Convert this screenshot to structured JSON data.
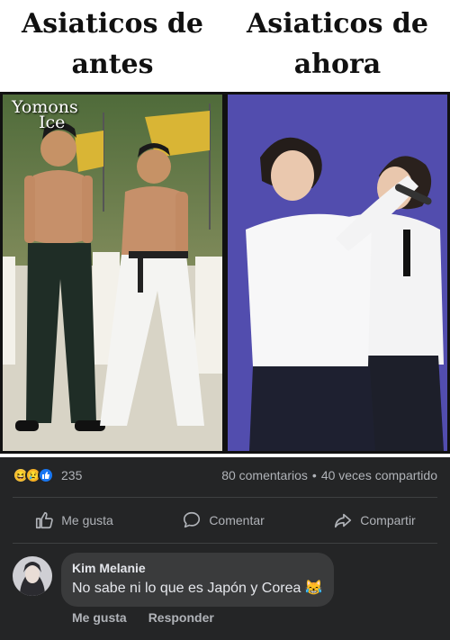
{
  "meme": {
    "left_title_line1": "Asiaticos de",
    "left_title_line2": "antes",
    "right_title_line1": "Asiaticos de",
    "right_title_line2": "ahora",
    "watermark_line1": "Yomons",
    "watermark_line2": "Ice"
  },
  "post_stats": {
    "reaction_icons": [
      "haha-icon",
      "sad-icon",
      "like-icon"
    ],
    "reaction_count": "235",
    "comments": "80 comentarios",
    "separator": "•",
    "shares": "40 veces compartido"
  },
  "actions": {
    "like": "Me gusta",
    "comment": "Comentar",
    "share": "Compartir"
  },
  "comment": {
    "author": "Kim Melanie",
    "text": "No sabe ni lo que es Japón y Corea",
    "emoji": "😹",
    "like": "Me gusta",
    "reply": "Responder"
  },
  "colors": {
    "background": "#18191a",
    "card": "#242526",
    "bubble": "#3a3b3c",
    "text": "#e4e6eb",
    "secondary_text": "#b0b3b8",
    "like_blue": "#1877f2"
  }
}
